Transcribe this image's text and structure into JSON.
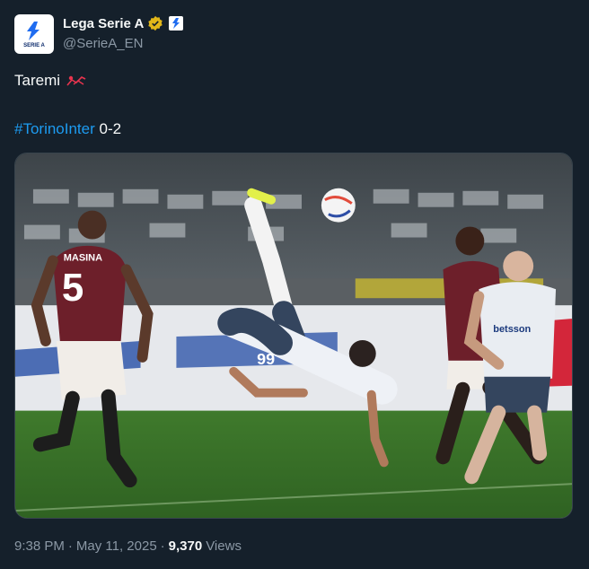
{
  "author": {
    "display_name": "Lega Serie A",
    "handle": "@SerieA_EN",
    "logo_text": "SERIE A",
    "verified_color": "#e2b719"
  },
  "tweet": {
    "text": "Taremi",
    "hashtag": "#TorinoInter",
    "score": " 0-2"
  },
  "media": {
    "shirt_left_name": "MASINA",
    "shirt_left_number": "5",
    "shirt_center_number": "99",
    "shirt_right_sponsor": "betsson"
  },
  "meta": {
    "time": "9:38 PM",
    "sep1": "·",
    "date": "May 11, 2025",
    "sep2": "·",
    "views_count": "9,370",
    "views_label": "Views"
  },
  "colors": {
    "background": "#15202b",
    "link": "#1d9bf0",
    "muted": "#8b98a5"
  }
}
